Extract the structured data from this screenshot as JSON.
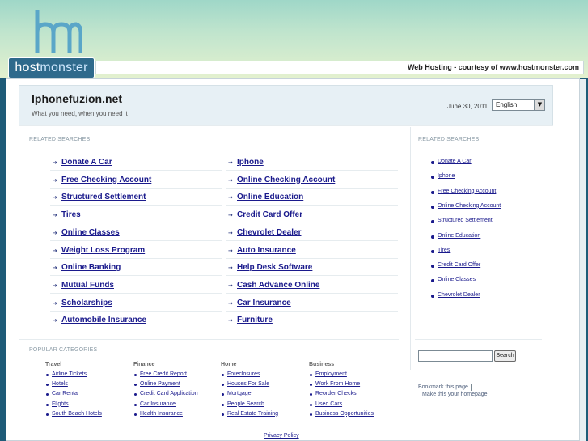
{
  "header": {
    "logo_text_a": "host",
    "logo_text_b": "monster",
    "courtesy": "Web Hosting - courtesy of www.hostmonster.com"
  },
  "site": {
    "title": "Iphonefuzion.net",
    "tagline": "What you need, when you need it",
    "date": "June 30, 2011",
    "language": "English"
  },
  "related_label": "RELATED SEARCHES",
  "main_links": {
    "col1": [
      "Donate A Car",
      "Free Checking Account",
      "Structured Settlement",
      "Tires",
      "Online Classes",
      "Weight Loss Program",
      "Online Banking",
      "Mutual Funds",
      "Scholarships",
      "Automobile Insurance"
    ],
    "col2": [
      "Iphone",
      "Online Checking Account",
      "Online Education",
      "Credit Card Offer",
      "Chevrolet Dealer",
      "Auto Insurance",
      "Help Desk Software",
      "Cash Advance Online",
      "Car Insurance",
      "Furniture"
    ]
  },
  "side_links": [
    "Donate A Car",
    "Iphone",
    "Free Checking Account",
    "Online Checking Account",
    "Structured Settlement",
    "Online Education",
    "Tires",
    "Credit Card Offer",
    "Online Classes",
    "Chevrolet Dealer"
  ],
  "popular_label": "POPULAR CATEGORIES",
  "categories": [
    {
      "head": "Travel",
      "items": [
        "Airline Tickets",
        "Hotels",
        "Car Rental",
        "Flights",
        "South Beach Hotels"
      ]
    },
    {
      "head": "Finance",
      "items": [
        "Free Credit Report",
        "Online Payment",
        "Credit Card Application",
        "Car Insurance",
        "Health Insurance"
      ]
    },
    {
      "head": "Home",
      "items": [
        "Foreclosures",
        "Houses For Sale",
        "Mortgage",
        "People Search",
        "Real Estate Training"
      ]
    },
    {
      "head": "Business",
      "items": [
        "Employment",
        "Work From Home",
        "Reorder Checks",
        "Used Cars",
        "Business Opportunities"
      ]
    }
  ],
  "search": {
    "button": "Search",
    "value": ""
  },
  "utility": {
    "bookmark": "Bookmark this page",
    "homepage": "Make this your homepage"
  },
  "footer": {
    "privacy": "Privacy Policy"
  },
  "colors": {
    "link": "#1a1a8c",
    "header_bg": "#bfe4cd",
    "logo_blue": "#2f6a8c"
  }
}
